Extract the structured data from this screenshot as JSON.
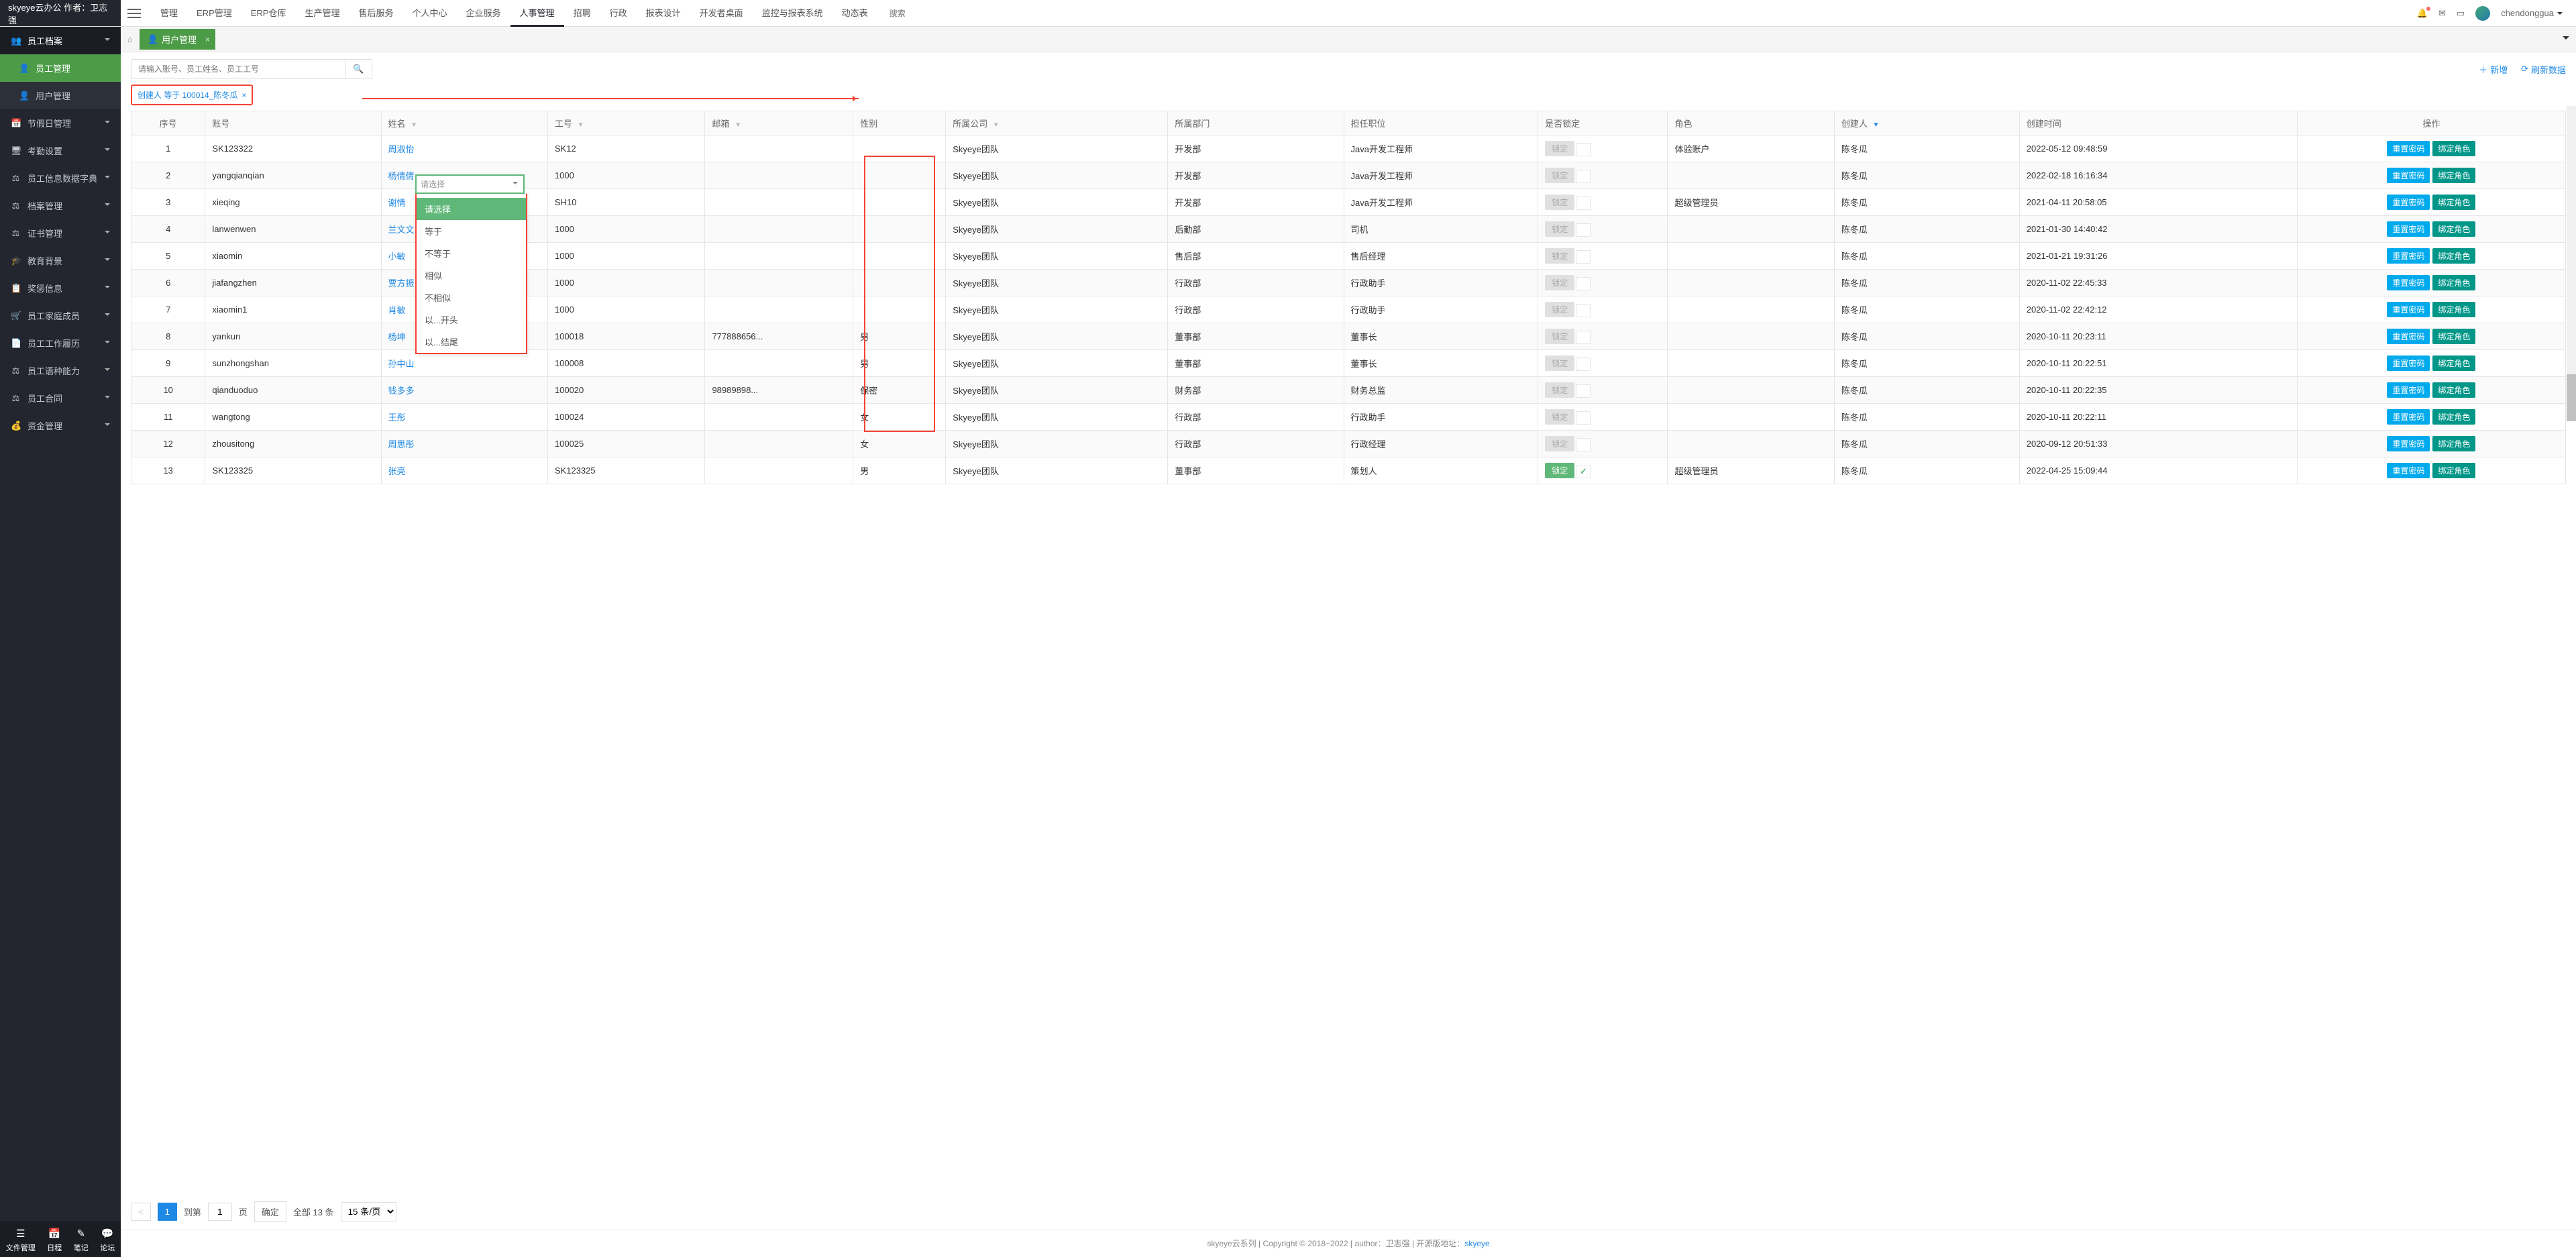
{
  "brand": "skyeye云办公 作者：卫志强",
  "topnav": [
    "管理",
    "ERP管理",
    "ERP仓库",
    "生产管理",
    "售后服务",
    "个人中心",
    "企业服务",
    "人事管理",
    "招聘",
    "行政",
    "报表设计",
    "开发者桌面",
    "监控与报表系统",
    "动态表"
  ],
  "topnav_active": 7,
  "search_placeholder": "搜索",
  "username": "chendonggua",
  "sidebar": {
    "section": "员工档案",
    "active_sub": "员工管理",
    "subs": [
      "员工管理",
      "用户管理"
    ],
    "items": [
      "节假日管理",
      "考勤设置",
      "员工信息数据字典",
      "档案管理",
      "证书管理",
      "教育背景",
      "奖惩信息",
      "员工家庭成员",
      "员工工作履历",
      "员工语种能力",
      "员工合同",
      "资金管理"
    ]
  },
  "bottom_tools": [
    "文件管理",
    "日程",
    "笔记",
    "论坛"
  ],
  "tab": {
    "label": "用户管理"
  },
  "toolbar": {
    "search_placeholder": "请输入账号、员工姓名、员工工号",
    "add": "新增",
    "refresh": "刷新数据"
  },
  "filter_chip": "创建人 等于 100014_陈冬瓜",
  "columns": [
    "序号",
    "账号",
    "姓名",
    "工号",
    "邮箱",
    "性别",
    "所属公司",
    "所属部门",
    "担任职位",
    "是否锁定",
    "角色",
    "创建人",
    "创建时间",
    "操作"
  ],
  "filter_select": {
    "placeholder": "请选择",
    "options": [
      "请选择",
      "等于",
      "不等于",
      "相似",
      "不相似",
      "以...开头",
      "以...结尾"
    ],
    "selected": 0
  },
  "rows": [
    {
      "idx": 1,
      "acct": "SK123322",
      "name": "周淑怡",
      "code": "SK12",
      "email": "",
      "sex": "",
      "company": "Skyeye团队",
      "dept": "开发部",
      "pos": "Java开发工程师",
      "locked": false,
      "role": "体验账户",
      "creator": "陈冬瓜",
      "time": "2022-05-12 09:48:59"
    },
    {
      "idx": 2,
      "acct": "yangqianqian",
      "name": "杨倩倩",
      "code": "1000",
      "email": "",
      "sex": "",
      "company": "Skyeye团队",
      "dept": "开发部",
      "pos": "Java开发工程师",
      "locked": false,
      "role": "",
      "creator": "陈冬瓜",
      "time": "2022-02-18 16:16:34"
    },
    {
      "idx": 3,
      "acct": "xieqing",
      "name": "谢情",
      "code": "SH10",
      "email": "",
      "sex": "",
      "company": "Skyeye团队",
      "dept": "开发部",
      "pos": "Java开发工程师",
      "locked": false,
      "role": "超级管理员",
      "creator": "陈冬瓜",
      "time": "2021-04-11 20:58:05"
    },
    {
      "idx": 4,
      "acct": "lanwenwen",
      "name": "兰文文",
      "code": "1000",
      "email": "",
      "sex": "",
      "company": "Skyeye团队",
      "dept": "后勤部",
      "pos": "司机",
      "locked": false,
      "role": "",
      "creator": "陈冬瓜",
      "time": "2021-01-30 14:40:42"
    },
    {
      "idx": 5,
      "acct": "xiaomin",
      "name": "小敏",
      "code": "1000",
      "email": "",
      "sex": "",
      "company": "Skyeye团队",
      "dept": "售后部",
      "pos": "售后经理",
      "locked": false,
      "role": "",
      "creator": "陈冬瓜",
      "time": "2021-01-21 19:31:26"
    },
    {
      "idx": 6,
      "acct": "jiafangzhen",
      "name": "贾方振",
      "code": "1000",
      "email": "",
      "sex": "",
      "company": "Skyeye团队",
      "dept": "行政部",
      "pos": "行政助手",
      "locked": false,
      "role": "",
      "creator": "陈冬瓜",
      "time": "2020-11-02 22:45:33"
    },
    {
      "idx": 7,
      "acct": "xiaomin1",
      "name": "肖敏",
      "code": "1000",
      "email": "",
      "sex": "",
      "company": "Skyeye团队",
      "dept": "行政部",
      "pos": "行政助手",
      "locked": false,
      "role": "",
      "creator": "陈冬瓜",
      "time": "2020-11-02 22:42:12"
    },
    {
      "idx": 8,
      "acct": "yankun",
      "name": "杨坤",
      "code": "100018",
      "email": "777888656...",
      "sex": "男",
      "company": "Skyeye团队",
      "dept": "董事部",
      "pos": "董事长",
      "locked": false,
      "role": "",
      "creator": "陈冬瓜",
      "time": "2020-10-11 20:23:11"
    },
    {
      "idx": 9,
      "acct": "sunzhongshan",
      "name": "孙中山",
      "code": "100008",
      "email": "",
      "sex": "男",
      "company": "Skyeye团队",
      "dept": "董事部",
      "pos": "董事长",
      "locked": false,
      "role": "",
      "creator": "陈冬瓜",
      "time": "2020-10-11 20:22:51"
    },
    {
      "idx": 10,
      "acct": "qianduoduo",
      "name": "钱多多",
      "code": "100020",
      "email": "98989898...",
      "sex": "保密",
      "company": "Skyeye团队",
      "dept": "财务部",
      "pos": "财务总监",
      "locked": false,
      "role": "",
      "creator": "陈冬瓜",
      "time": "2020-10-11 20:22:35"
    },
    {
      "idx": 11,
      "acct": "wangtong",
      "name": "王彤",
      "code": "100024",
      "email": "",
      "sex": "女",
      "company": "Skyeye团队",
      "dept": "行政部",
      "pos": "行政助手",
      "locked": false,
      "role": "",
      "creator": "陈冬瓜",
      "time": "2020-10-11 20:22:11"
    },
    {
      "idx": 12,
      "acct": "zhousitong",
      "name": "周思彤",
      "code": "100025",
      "email": "",
      "sex": "女",
      "company": "Skyeye团队",
      "dept": "行政部",
      "pos": "行政经理",
      "locked": false,
      "role": "",
      "creator": "陈冬瓜",
      "time": "2020-09-12 20:51:33"
    },
    {
      "idx": 13,
      "acct": "SK123325",
      "name": "张亮",
      "code": "SK123325",
      "email": "",
      "sex": "男",
      "company": "Skyeye团队",
      "dept": "董事部",
      "pos": "策划人",
      "locked": true,
      "role": "超级管理员",
      "creator": "陈冬瓜",
      "time": "2022-04-25 15:09:44"
    }
  ],
  "actions": {
    "reset": "重置密码",
    "bind": "绑定角色"
  },
  "lock_label": "锁定",
  "pager": {
    "prev": "<",
    "page": 1,
    "goto_label": "到第",
    "page_label": "页",
    "confirm": "确定",
    "total": "全部 13 条",
    "size": "15 条/页"
  },
  "footer": {
    "text1": "skyeye云系列 | Copyright © 2018~2022 | author：卫志强 | 开源版地址：",
    "link": "skyeye"
  }
}
